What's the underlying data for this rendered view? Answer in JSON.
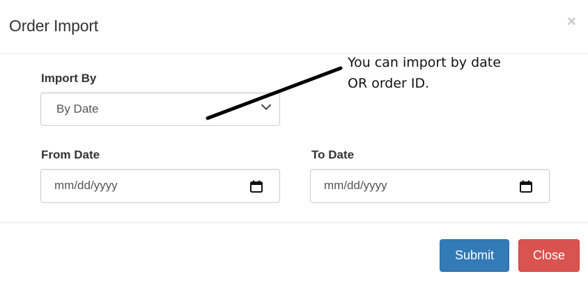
{
  "modal": {
    "title": "Order Import",
    "close_glyph": "×"
  },
  "form": {
    "import_by": {
      "label": "Import By",
      "selected": "By Date"
    },
    "from_date": {
      "label": "From Date",
      "placeholder": "mm/dd/yyyy"
    },
    "to_date": {
      "label": "To Date",
      "placeholder": "mm/dd/yyyy"
    }
  },
  "annotation": {
    "line1": "You can import by date",
    "line2": "OR order ID."
  },
  "footer": {
    "submit_label": "Submit",
    "close_label": "Close"
  },
  "colors": {
    "primary": "#337ab7",
    "danger": "#d9534f"
  },
  "icons": {
    "dropdown": "chevron-down-icon",
    "date_picker": "calendar-icon",
    "dismiss": "close-icon"
  }
}
